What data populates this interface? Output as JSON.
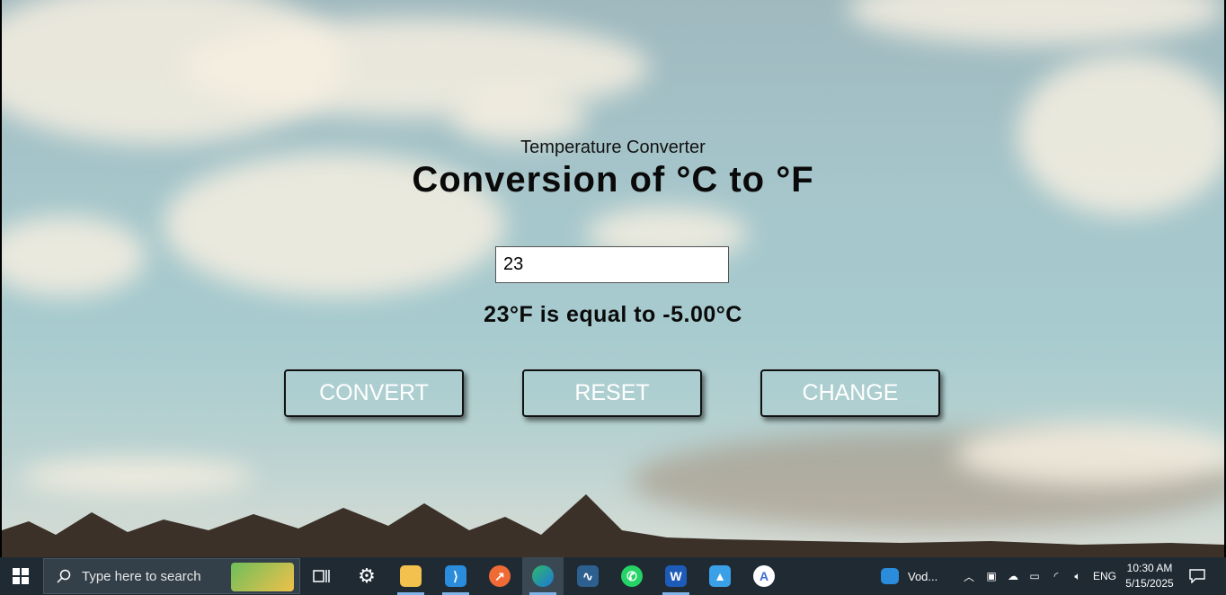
{
  "app": {
    "subtitle": "Temperature Converter",
    "title": "Conversion of °C to °F",
    "input_value": "23",
    "result": "23°F is equal to -5.00°C",
    "buttons": {
      "convert": "CONVERT",
      "reset": "RESET",
      "change": "CHANGE"
    }
  },
  "taskbar": {
    "search_placeholder": "Type here to search",
    "pinned_app_label": "Vod...",
    "language": "ENG",
    "time": "10:30 AM",
    "date": "5/15/2025",
    "apps": [
      "task-view-icon",
      "settings-icon",
      "file-explorer-icon",
      "vscode-icon",
      "postman-icon",
      "edge-icon",
      "azure-data-studio-icon",
      "whatsapp-icon",
      "word-icon",
      "photos-icon",
      "android-studio-icon"
    ]
  }
}
